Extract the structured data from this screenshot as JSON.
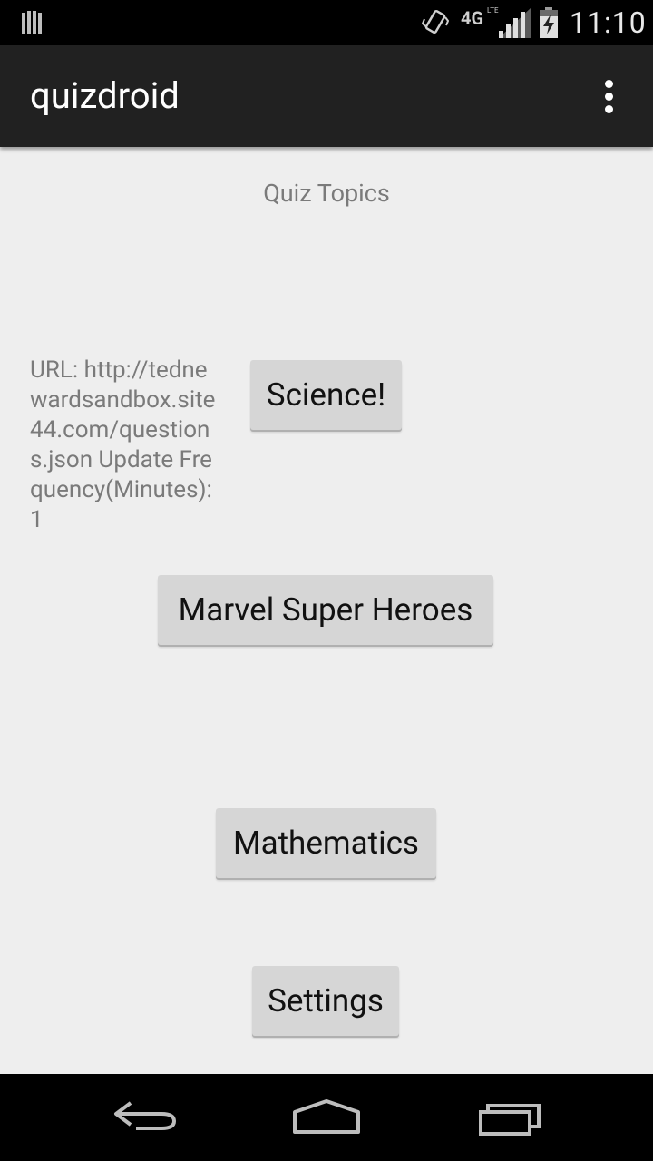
{
  "status_bar": {
    "network": "4G",
    "network_sub": "LTE",
    "time": "11:10"
  },
  "action_bar": {
    "title": "quizdroid",
    "overflow_icon": "more-vert-icon"
  },
  "main": {
    "heading": "Quiz Topics",
    "url_info": "URL: http://tednewardsandbox.site44.com/questions.json Update Frequency(Minutes): 1",
    "buttons": {
      "science": "Science!",
      "marvel": "Marvel Super Heroes",
      "math": "Mathematics",
      "settings": "Settings"
    }
  },
  "nav_bar": {
    "back_icon": "back-icon",
    "home_icon": "home-icon",
    "recents_icon": "recents-icon"
  },
  "colors": {
    "status_bar_bg": "#000000",
    "action_bar_bg": "#212121",
    "content_bg": "#eeeeee",
    "button_bg": "#d6d6d6",
    "secondary_text": "#7a7a7a"
  }
}
